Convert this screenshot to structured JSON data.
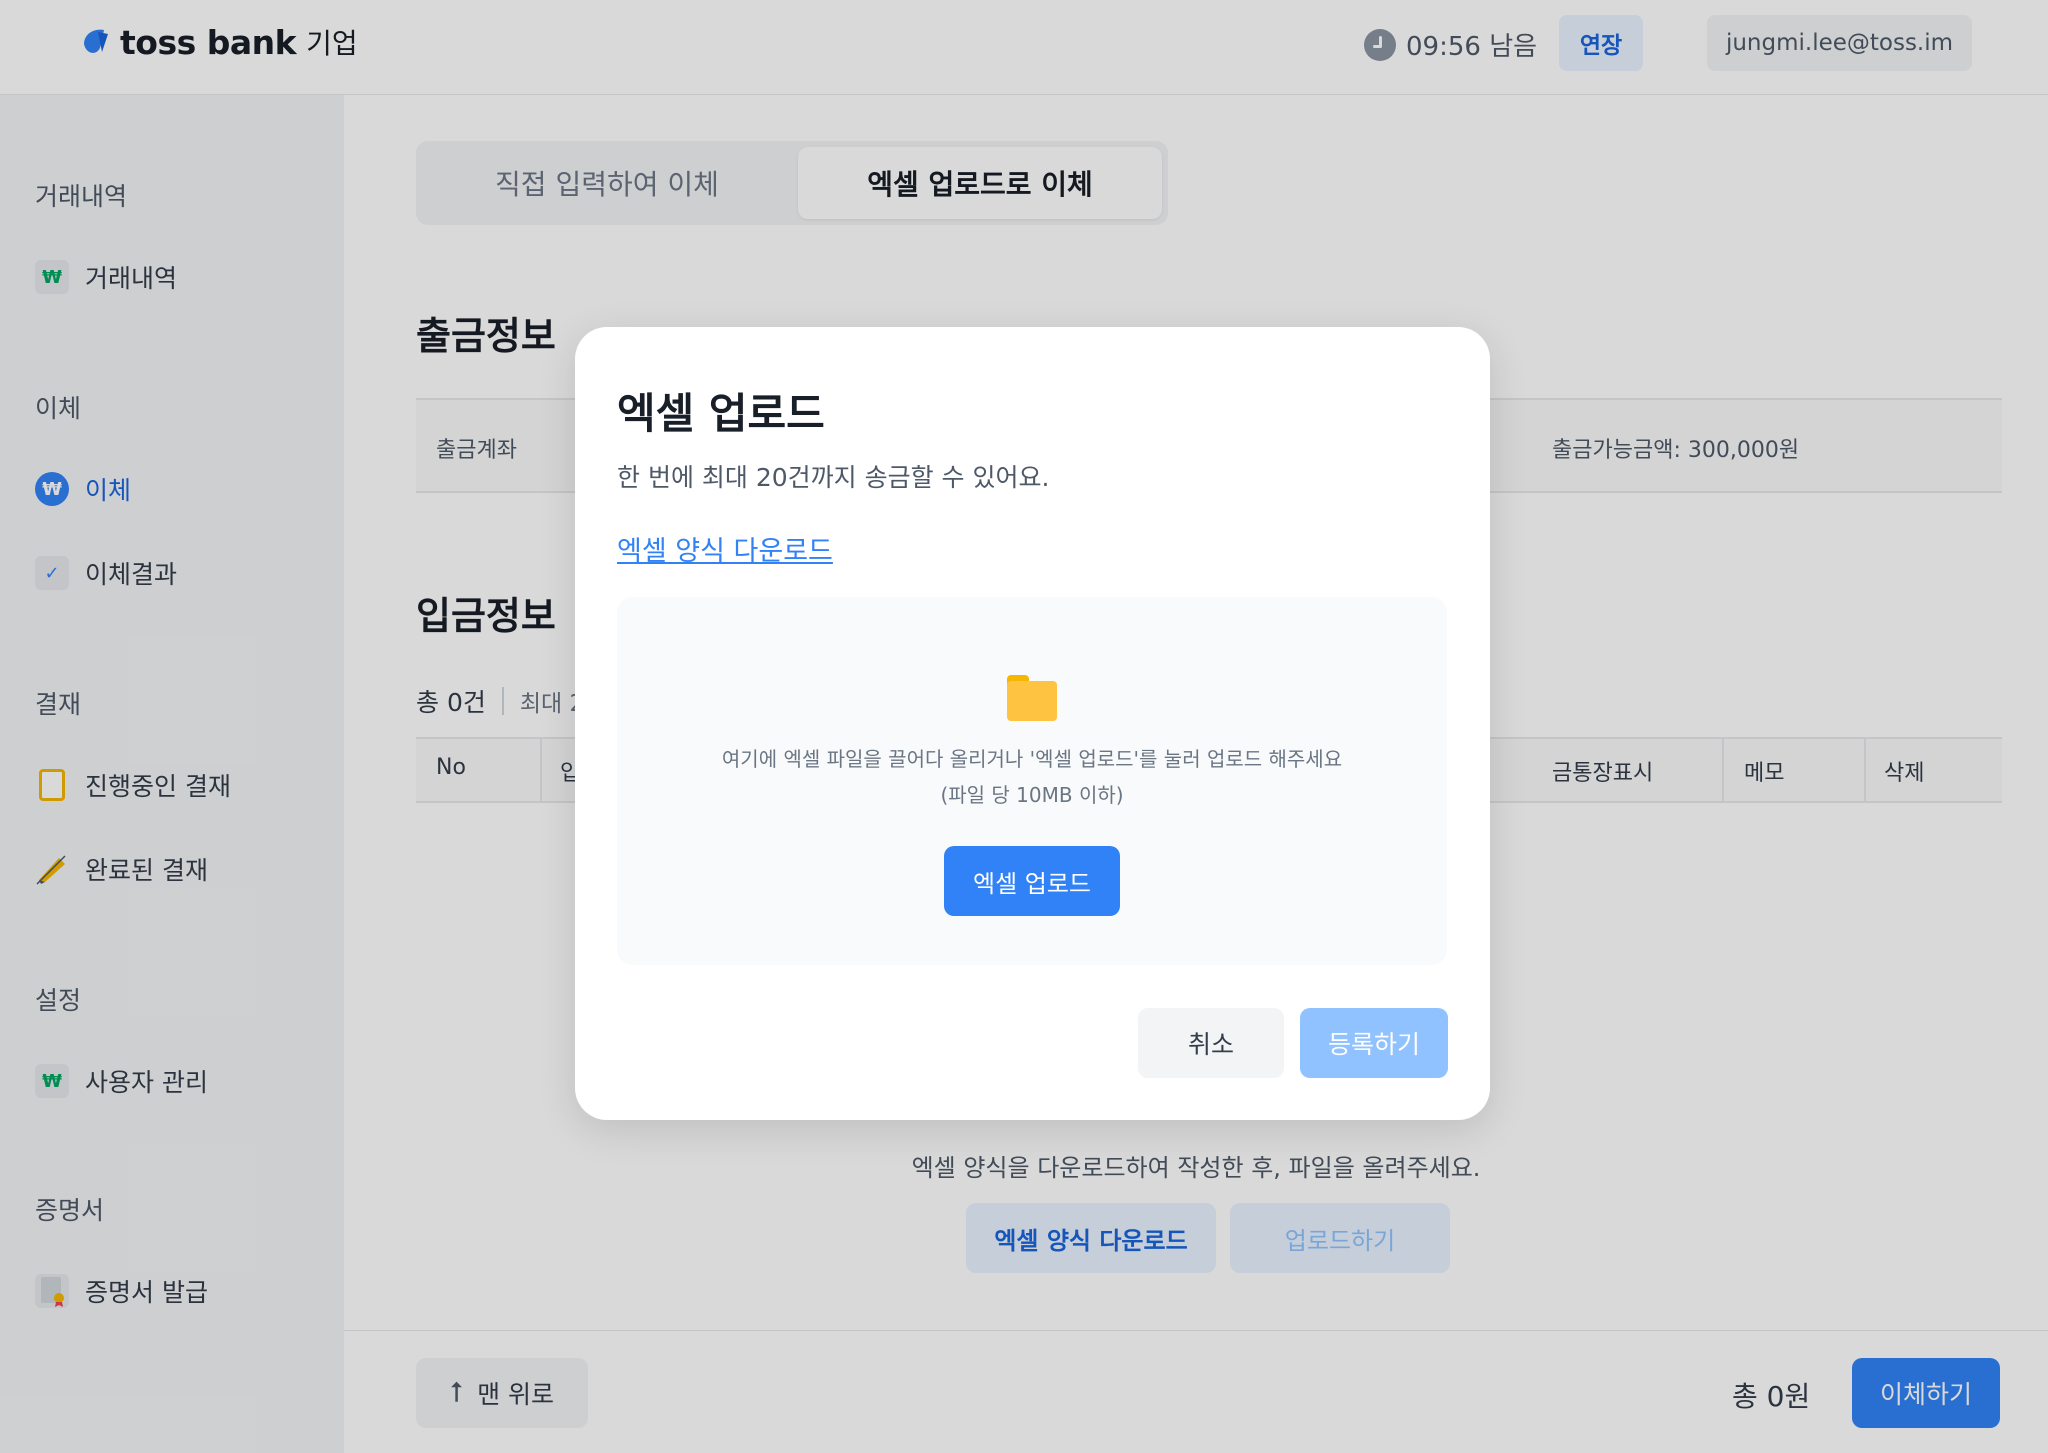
{
  "header": {
    "logo_text": "toss bank",
    "logo_sub": "기업",
    "timer_text": "09:56 남음",
    "extend_label": "연장",
    "user_email": "jungmi.lee@toss.im"
  },
  "sidebar": {
    "sections": [
      {
        "title": "거래내역",
        "items": [
          {
            "label": "거래내역"
          }
        ]
      },
      {
        "title": "이체",
        "items": [
          {
            "label": "이체"
          },
          {
            "label": "이체결과"
          }
        ]
      },
      {
        "title": "결재",
        "items": [
          {
            "label": "진행중인 결재"
          },
          {
            "label": "완료된 결재"
          }
        ]
      },
      {
        "title": "설정",
        "items": [
          {
            "label": "사용자 관리"
          }
        ]
      },
      {
        "title": "증명서",
        "items": [
          {
            "label": "증명서 발급"
          }
        ]
      }
    ]
  },
  "main": {
    "tabs": [
      {
        "label": "직접 입력하여 이체"
      },
      {
        "label": "엑셀 업로드로 이체"
      }
    ],
    "withdraw_title": "출금정보",
    "withdraw_account_label": "출금계좌",
    "available_amount": "출금가능금액: 300,000원",
    "deposit_title": "입금정보",
    "count_text": "총 0건",
    "max_text": "최대 2",
    "table_headers": {
      "no": "No",
      "col2": "입",
      "bank_display": "금통장표시",
      "memo": "메모",
      "delete": "삭제"
    },
    "empty_desc": "엑셀 양식을 다운로드하여 작성한 후, 파일을 올려주세요.",
    "download_btn": "엑셀 양식 다운로드",
    "upload_btn": "업로드하기"
  },
  "bottom": {
    "top_btn": "맨 위로",
    "total": "총 0원",
    "transfer_btn": "이체하기"
  },
  "modal": {
    "title": "엑셀 업로드",
    "desc": "한 번에 최대 20건까지 송금할 수 있어요.",
    "link": "엑셀 양식 다운로드",
    "drop_line1": "여기에 엑셀 파일을 끌어다 올리거나 '엑셀 업로드'를 눌러 업로드 해주세요",
    "drop_line2": "(파일 당 10MB 이하)",
    "upload_btn": "엑셀 업로드",
    "cancel_btn": "취소",
    "register_btn": "등록하기"
  },
  "colors": {
    "accent": "#3182f6",
    "accent_light": "#e8f3ff",
    "disabled": "#90c2ff"
  },
  "icons": [
    "clock-icon",
    "won-icon",
    "check-icon",
    "clipboard-icon",
    "pen-icon",
    "certificate-icon",
    "arrow-up-icon",
    "folder-icon"
  ]
}
